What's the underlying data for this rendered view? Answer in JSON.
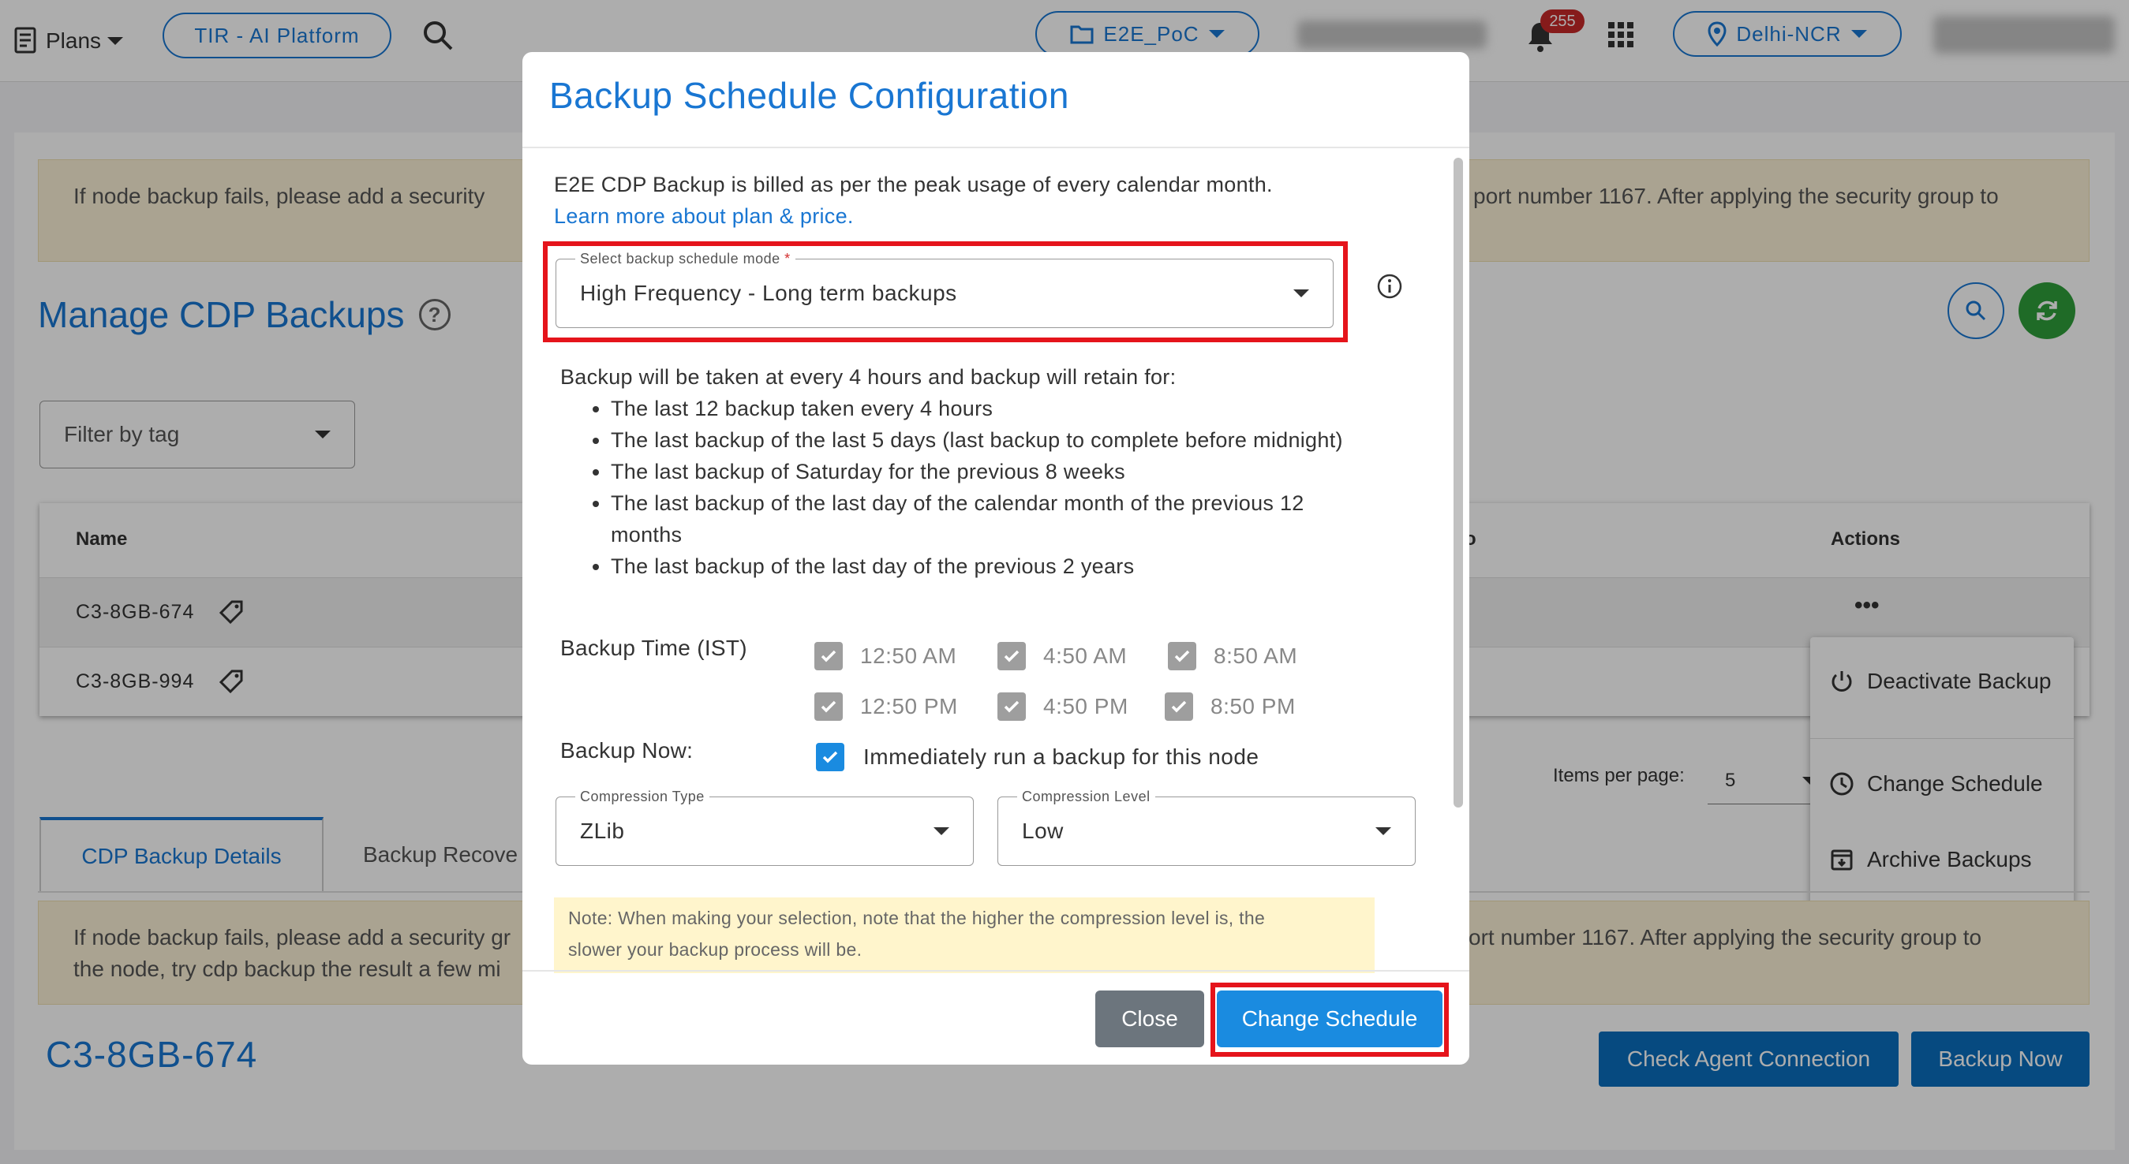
{
  "topbar": {
    "plans_label": "Plans",
    "platform_label": "TIR - AI Platform",
    "project_label": "E2E_PoC",
    "notification_count": "255",
    "region_label": "Delhi-NCR"
  },
  "page": {
    "banner_text_left": "If node backup fails, please add a security",
    "banner_text_right": "port number 1167. After applying the security group to",
    "title": "Manage CDP Backups",
    "filter_placeholder": "Filter by tag",
    "table": {
      "col_name": "Name",
      "col_partial": "o",
      "col_actions": "Actions",
      "rows": [
        {
          "name": "C3-8GB-674",
          "actions": "•••"
        },
        {
          "name": "C3-8GB-994"
        }
      ]
    },
    "items_per_page_label": "Items per page:",
    "items_per_page_value": "5",
    "actions_menu": {
      "deactivate": "Deactivate Backup",
      "change_schedule": "Change Schedule",
      "archive": "Archive Backups"
    },
    "tabs": {
      "details": "CDP Backup Details",
      "recovery": "Backup Recove"
    },
    "banner2_left_line1": "If node backup fails, please add a security gr",
    "banner2_left_line2": "the node, try cdp backup the result a few mi",
    "banner2_right": "ort number 1167. After applying the security group to",
    "node_name": "C3-8GB-674",
    "check_agent_button": "Check Agent Connection",
    "backup_now_button": "Backup Now"
  },
  "modal": {
    "title": "Backup Schedule Configuration",
    "billing_text": "E2E CDP Backup is billed as per the peak usage of every calendar month.",
    "learn_more": "Learn more about plan & price.",
    "schedule_mode_label": "Select backup schedule mode",
    "schedule_mode_required": "*",
    "schedule_mode_value": "High Frequency - Long term backups",
    "schedule_description": "Backup will be taken at every 4 hours and backup will retain for:",
    "bullets": [
      "The last 12 backup taken every 4 hours",
      "The last backup of the last 5 days (last backup to complete before midnight)",
      "The last backup of Saturday for the previous 8 weeks",
      "The last backup of the last day of the calendar month of the previous 12",
      "months",
      "The last backup of the last day of the previous 2 years"
    ],
    "backup_time_label": "Backup Time (IST)",
    "times": [
      "12:50 AM",
      "4:50 AM",
      "8:50 AM",
      "12:50 PM",
      "4:50 PM",
      "8:50 PM"
    ],
    "backup_now_label": "Backup Now:",
    "backup_now_checkbox": "Immediately run a backup for this node",
    "compression_type_label": "Compression Type",
    "compression_type_value": "ZLib",
    "compression_level_label": "Compression Level",
    "compression_level_value": "Low",
    "note_line1": "Note: When making your selection, note that the higher the compression level is, the",
    "note_line2": "slower your backup process will be.",
    "close_button": "Close",
    "change_button": "Change Schedule"
  },
  "colors": {
    "primary": "#1976d2",
    "highlight_box": "#e5141b",
    "refresh_button": "#2e9e3a",
    "notification_badge": "#c62828",
    "banner_bg": "#fbf1d6"
  }
}
